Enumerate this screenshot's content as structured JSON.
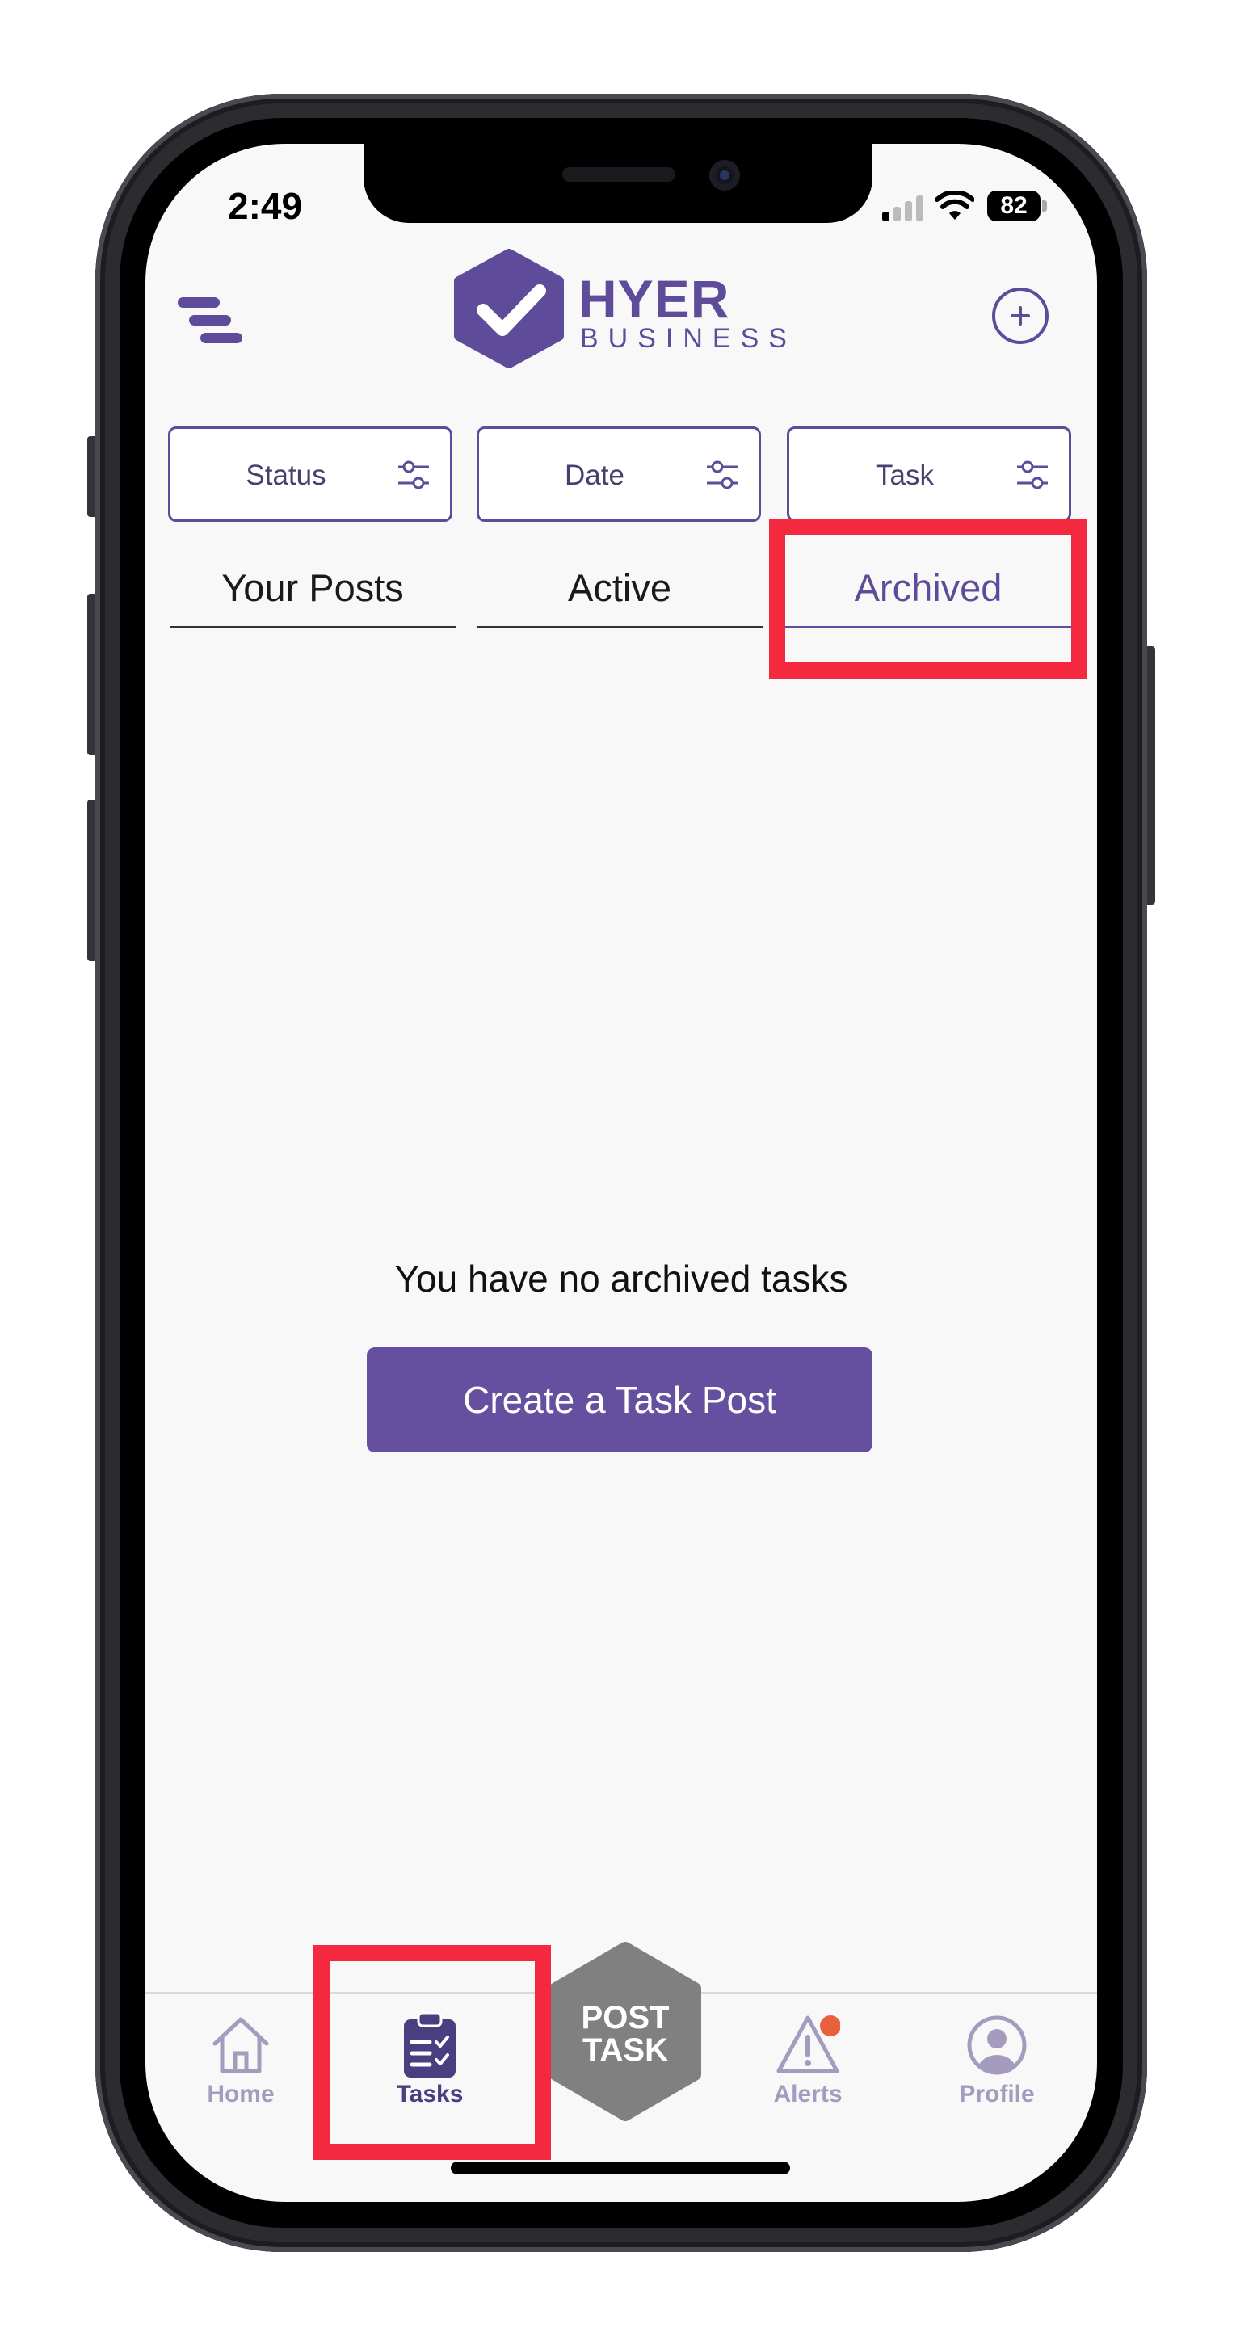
{
  "status_bar": {
    "time": "2:49",
    "battery": "82"
  },
  "brand": {
    "name": "HYER",
    "tagline": "BUSINESS"
  },
  "filters": [
    {
      "label": "Status"
    },
    {
      "label": "Date"
    },
    {
      "label": "Task"
    }
  ],
  "tabs": [
    {
      "label": "Your Posts",
      "active": false
    },
    {
      "label": "Active",
      "active": false
    },
    {
      "label": "Archived",
      "active": true
    }
  ],
  "empty_state": {
    "message": "You have no archived tasks",
    "button_label": "Create a Task Post"
  },
  "bottom_nav": {
    "items": [
      {
        "label": "Home",
        "icon": "home-icon"
      },
      {
        "label": "Tasks",
        "icon": "tasks-clipboard-icon",
        "current": true
      },
      {
        "label": "Alerts",
        "icon": "alert-icon"
      },
      {
        "label": "Profile",
        "icon": "profile-icon"
      }
    ],
    "post_task": {
      "line1": "POST",
      "line2": "TASK"
    }
  },
  "colors": {
    "brand_purple": "#5e4b99",
    "button_purple": "#65509f",
    "highlight_red": "#f4293f",
    "alert_dot": "#e8603c",
    "post_task_gray": "#808080"
  }
}
